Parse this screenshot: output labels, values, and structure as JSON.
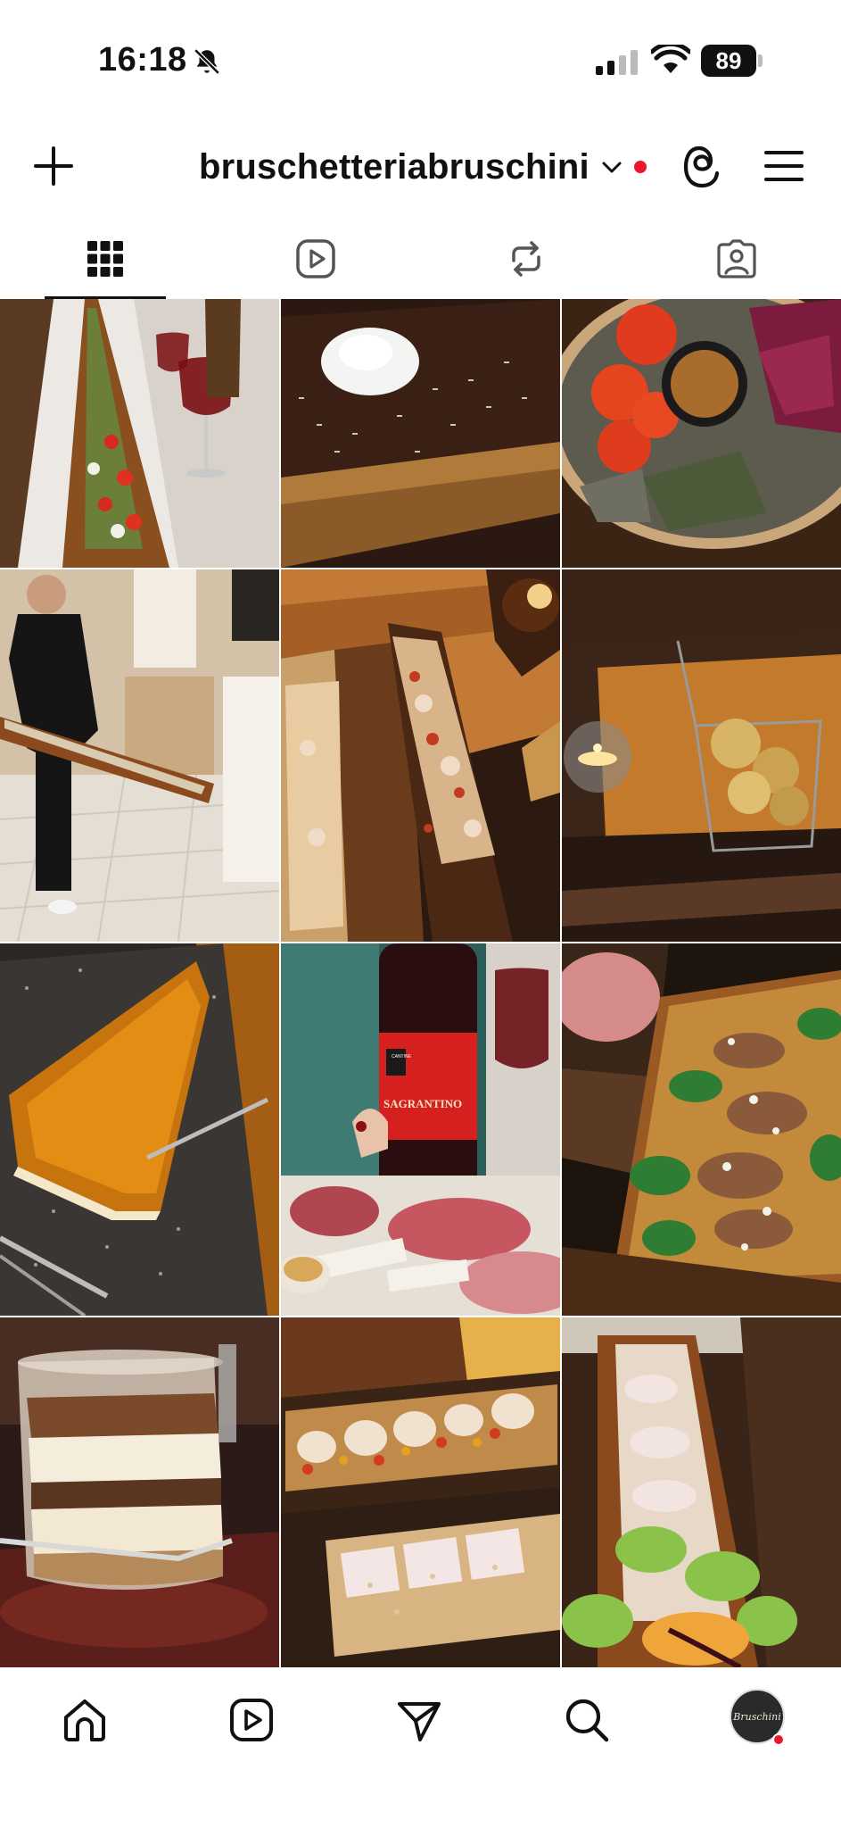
{
  "status_bar": {
    "time": "16:18",
    "battery": "89",
    "icons": [
      "bell-slash-icon",
      "cellular-signal-icon",
      "wifi-icon",
      "battery-icon"
    ]
  },
  "header": {
    "username": "bruschetteriabruschini",
    "icons": [
      "plus-icon",
      "chevron-down-icon",
      "threads-icon",
      "hamburger-menu-icon"
    ],
    "notification_dot_color": "#e8192c"
  },
  "tabs": [
    {
      "name": "posts-grid",
      "icon": "grid-icon",
      "active": true
    },
    {
      "name": "reels",
      "icon": "reels-icon",
      "active": false
    },
    {
      "name": "reposts",
      "icon": "repost-icon",
      "active": false
    },
    {
      "name": "tagged",
      "icon": "tagged-person-icon",
      "active": false
    }
  ],
  "posts": {
    "wine_bottle_label": "MONTEFALCO",
    "wine_bottle_name": "SAGRANTINO"
  },
  "bottom_nav": {
    "items": [
      "home-icon",
      "reels-icon",
      "send-icon",
      "search-icon",
      "profile-avatar"
    ],
    "avatar_text": "Bruschini"
  }
}
